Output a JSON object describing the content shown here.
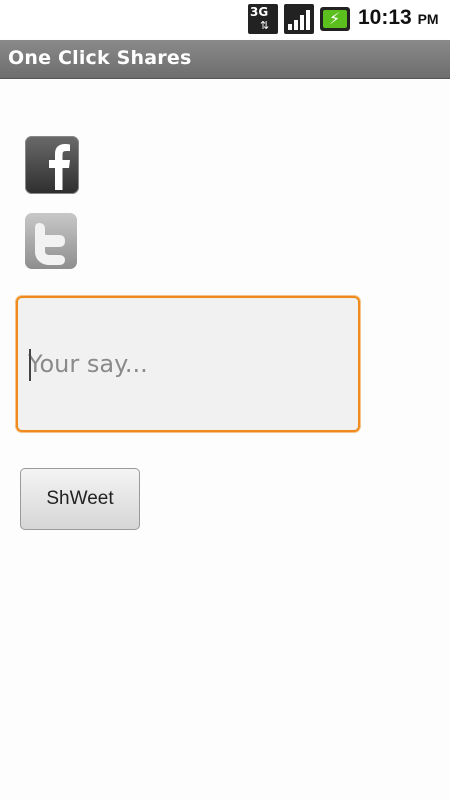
{
  "status_bar": {
    "network_label": "3G",
    "network_arrows": "⇅",
    "time": "10:13",
    "ampm": "PM",
    "icons": [
      "network-3g-icon",
      "signal-icon",
      "battery-charging-icon"
    ],
    "battery_color": "#5bbf1e"
  },
  "app": {
    "title": "One Click Shares"
  },
  "share_targets": {
    "facebook_icon": "facebook-icon",
    "twitter_icon": "twitter-icon"
  },
  "compose": {
    "placeholder": "Your say...",
    "value": "",
    "focus_color": "#f08a1c"
  },
  "actions": {
    "submit_label": "ShWeet"
  }
}
